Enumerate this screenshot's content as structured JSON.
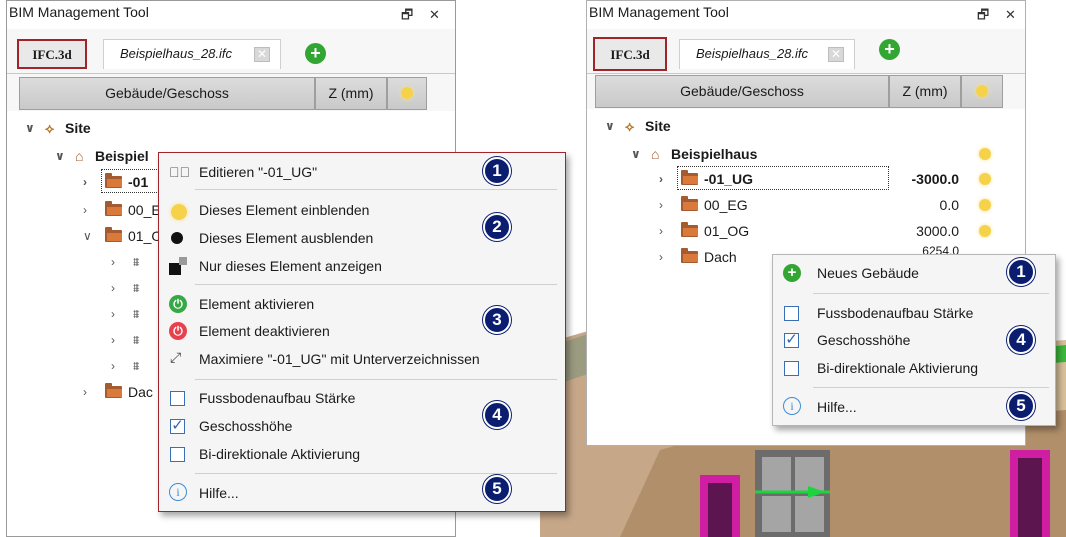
{
  "left_panel": {
    "title": "BIM Management Tool",
    "float_btn": "🗗",
    "close_btn": "✕",
    "tab_active": "IFC.3d",
    "tab_file": "Beispielhaus_28.ifc",
    "tab_close": "✕",
    "add": "+",
    "header": {
      "name": "Gebäude/Geschoss",
      "z": "Z (mm)"
    },
    "tree": {
      "site": "Site",
      "building": "Beispiel",
      "floor1": "-01",
      "floor2": "00_E",
      "floor3": "01_O",
      "dach": "Dac"
    }
  },
  "context_menu": {
    "items": [
      {
        "label": "Editieren \"-01_UG\""
      },
      {
        "label": "Dieses Element einblenden"
      },
      {
        "label": "Dieses Element ausblenden"
      },
      {
        "label": "Nur dieses Element anzeigen"
      },
      {
        "label": "Element aktivieren"
      },
      {
        "label": "Element deaktivieren"
      },
      {
        "label": "Maximiere \"-01_UG\" mit Unterverzeichnissen"
      },
      {
        "label": "Fussbodenaufbau Stärke"
      },
      {
        "label": "Geschosshöhe"
      },
      {
        "label": "Bi-direktionale Aktivierung"
      },
      {
        "label": "Hilfe..."
      }
    ],
    "badges": [
      "1",
      "2",
      "3",
      "4",
      "5"
    ],
    "checks": {
      "fussboden": false,
      "geschosshoehe": true,
      "bidirektional": false
    }
  },
  "right_panel": {
    "title": "BIM Management Tool",
    "float_btn": "🗗",
    "close_btn": "✕",
    "tab_active": "IFC.3d",
    "tab_file": "Beispielhaus_28.ifc",
    "tab_close": "✕",
    "add": "+",
    "header": {
      "name": "Gebäude/Geschoss",
      "z": "Z (mm)"
    },
    "tree": {
      "site": "Site",
      "building": "Beispielhaus",
      "rows": [
        {
          "label": "-01_UG",
          "z": "-3000.0"
        },
        {
          "label": "00_EG",
          "z": "0.0"
        },
        {
          "label": "01_OG",
          "z": "3000.0"
        },
        {
          "label": "Dach",
          "z": "6254.0"
        }
      ]
    }
  },
  "right_menu": {
    "items": [
      {
        "label": "Neues Gebäude"
      },
      {
        "label": "Fussbodenaufbau Stärke"
      },
      {
        "label": "Geschosshöhe"
      },
      {
        "label": "Bi-direktionale Aktivierung"
      },
      {
        "label": "Hilfe..."
      }
    ],
    "badges": [
      "1",
      "4",
      "5"
    ],
    "checks": {
      "fussboden": false,
      "geschosshoehe": true,
      "bidirektional": false
    }
  },
  "colors": {
    "accent_red": "#a0242a",
    "badge_navy": "#0b1d6f",
    "folder_brown": "#d97a3b",
    "add_green": "#33a532",
    "power_green": "#36a845",
    "power_red": "#e8414b",
    "bulb_yellow": "#f6d24b"
  }
}
